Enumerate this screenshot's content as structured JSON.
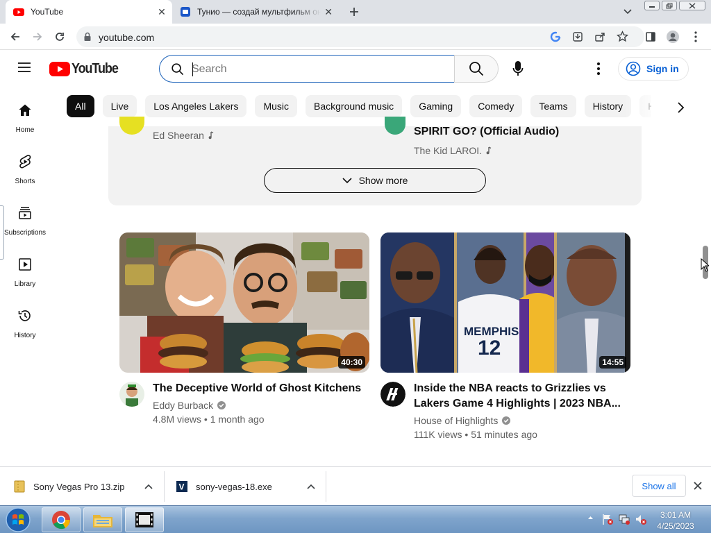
{
  "browser": {
    "tabs": [
      {
        "title": "YouTube",
        "favicon": "youtube-icon"
      },
      {
        "title": "Тунио — создай мультфильм он",
        "favicon": "tunio-icon"
      }
    ],
    "url": "youtube.com"
  },
  "youtube": {
    "logo_text": "YouTube",
    "search": {
      "placeholder": "Search",
      "value": ""
    },
    "signin_label": "Sign in",
    "chips": [
      "All",
      "Live",
      "Los Angeles Lakers",
      "Music",
      "Background music",
      "Gaming",
      "Comedy",
      "Teams",
      "History",
      "H"
    ],
    "active_chip": "All",
    "guide": [
      {
        "label": "Home",
        "icon": "home-icon"
      },
      {
        "label": "Shorts",
        "icon": "shorts-icon"
      },
      {
        "label": "Subscriptions",
        "icon": "subscriptions-icon"
      },
      {
        "label": "Library",
        "icon": "library-icon"
      },
      {
        "label": "History",
        "icon": "history-icon"
      }
    ],
    "shelf": {
      "left_channel": "Ed Sheeran",
      "right_title": "SPIRIT GO? (Official Audio)",
      "right_channel": "The Kid LAROI.",
      "show_more_label": "Show more"
    },
    "videos": [
      {
        "title": "The Deceptive World of Ghost Kitchens",
        "channel": "Eddy Burback",
        "verified": true,
        "views": "4.8M views",
        "age": "1 month ago",
        "duration": "40:30"
      },
      {
        "title_line1": "Inside the NBA reacts to Grizzlies vs",
        "title_line2": "Lakers Game 4 Highlights | 2023 NBA...",
        "channel": "House of Highlights",
        "verified": true,
        "views": "111K views",
        "age": "51 minutes ago",
        "duration": "14:55",
        "jersey_team": "MEMPHIS",
        "jersey_number": "12"
      }
    ]
  },
  "downloads": {
    "items": [
      {
        "name": "Sony Vegas Pro 13.zip"
      },
      {
        "name": "sony-vegas-18.exe"
      }
    ],
    "show_all_label": "Show all"
  },
  "taskbar": {
    "time": "3:01 AM",
    "date": "4/25/2023"
  },
  "colors": {
    "youtube_red": "#ff0000",
    "link_blue": "#065fd4",
    "chip_active": "#0f0f0f",
    "taskbar": "#7fa4cc"
  }
}
